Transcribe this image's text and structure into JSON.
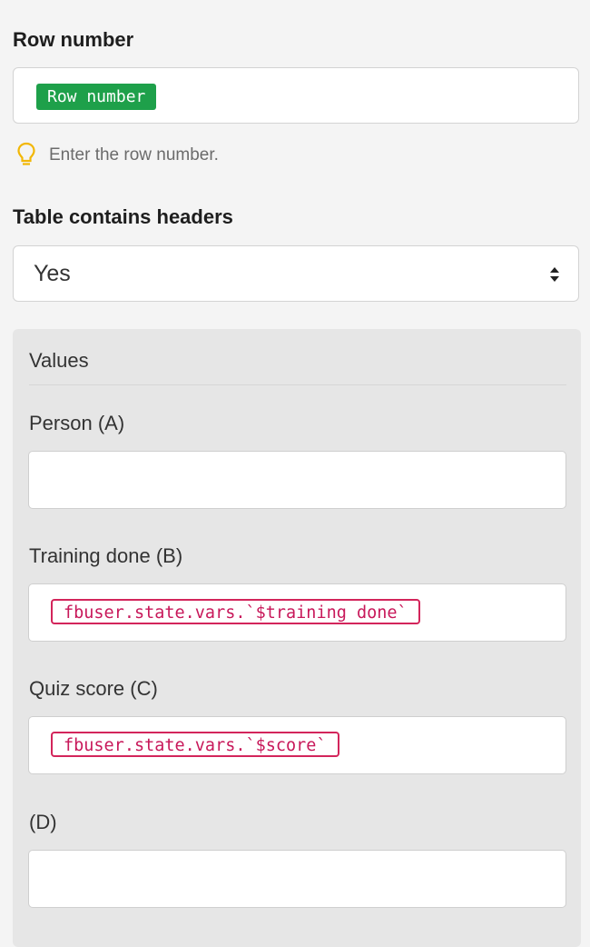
{
  "row_number": {
    "label": "Row number",
    "token": "Row number",
    "hint_icon": "lightbulb-icon",
    "hint": "Enter the row number."
  },
  "headers": {
    "label": "Table contains headers",
    "selected": "Yes",
    "arrow_icon": "sort-arrows-icon"
  },
  "values": {
    "title": "Values",
    "fields": [
      {
        "label": "Person (A)",
        "value": ""
      },
      {
        "label": "Training done (B)",
        "value": "fbuser.state.vars.`$training done`"
      },
      {
        "label": "Quiz score (C)",
        "value": "fbuser.state.vars.`$score`"
      },
      {
        "label": "(D)",
        "value": ""
      }
    ]
  },
  "colors": {
    "token_green": "#1ea04a",
    "token_red": "#d3255b",
    "hint_icon": "#f2b705"
  }
}
